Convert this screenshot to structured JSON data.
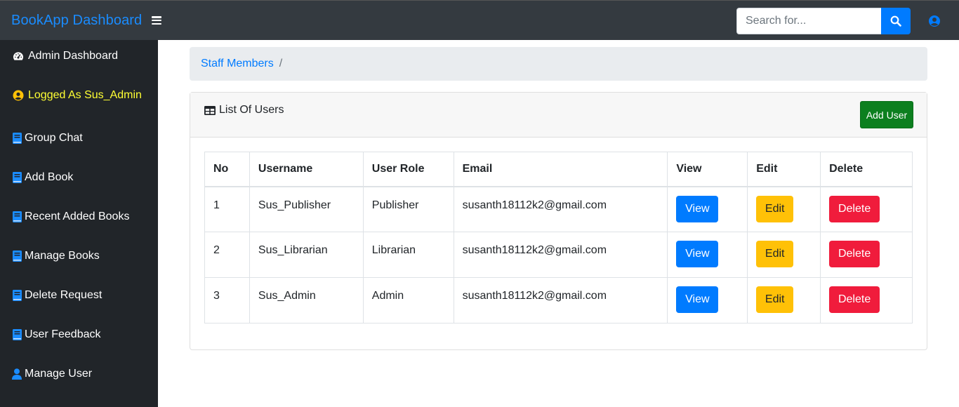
{
  "app": {
    "title": "BookApp Dashboard"
  },
  "search": {
    "placeholder": "Search for..."
  },
  "sidebar": {
    "items": [
      {
        "label": "Admin Dashboard",
        "icon": "tachometer-icon"
      },
      {
        "label": "Logged As Sus_Admin",
        "icon": "user-circle-icon"
      },
      {
        "label": "Group Chat",
        "icon": "book-icon"
      },
      {
        "label": "Add Book",
        "icon": "book-icon"
      },
      {
        "label": "Recent Added Books",
        "icon": "book-icon"
      },
      {
        "label": "Manage Books",
        "icon": "book-icon"
      },
      {
        "label": "Delete Request",
        "icon": "book-icon"
      },
      {
        "label": "User Feedback",
        "icon": "book-icon"
      },
      {
        "label": "Manage User",
        "icon": "user-icon"
      }
    ]
  },
  "breadcrumb": {
    "link": "Staff Members",
    "separator": "/"
  },
  "card": {
    "title": "List Of Users",
    "add_button": "Add User"
  },
  "table": {
    "headers": [
      "No",
      "Username",
      "User Role",
      "Email",
      "View",
      "Edit",
      "Delete"
    ],
    "rows": [
      {
        "no": "1",
        "username": "Sus_Publisher",
        "role": "Publisher",
        "email": "susanth18112k2@gmail.com",
        "view": "View",
        "edit": "Edit",
        "delete": "Delete"
      },
      {
        "no": "2",
        "username": "Sus_Librarian",
        "role": "Librarian",
        "email": "susanth18112k2@gmail.com",
        "view": "View",
        "edit": "Edit",
        "delete": "Delete"
      },
      {
        "no": "3",
        "username": "Sus_Admin",
        "role": "Admin",
        "email": "susanth18112k2@gmail.com",
        "view": "View",
        "edit": "Edit",
        "delete": "Delete"
      }
    ]
  },
  "colors": {
    "brand": "#1a8cff",
    "topbar": "#343a40",
    "sidebar": "#212529",
    "logged_user": "#ffff33",
    "primary": "#007bff",
    "warning": "#ffc107",
    "danger": "#f01c3c",
    "success": "#0c7f1f"
  }
}
